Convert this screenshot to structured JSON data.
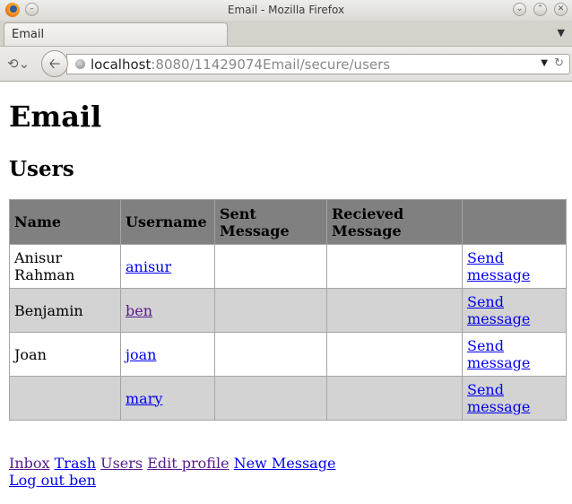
{
  "window": {
    "title": "Email - Mozilla Firefox"
  },
  "tab": {
    "label": "Email"
  },
  "urlbar": {
    "host": "localhost",
    "rest": ":8080/11429074Email/secure/users"
  },
  "page": {
    "heading": "Email",
    "subheading": "Users",
    "table": {
      "headers": {
        "name": "Name",
        "username": "Username",
        "sent": "Sent Message",
        "received": "Recieved Message",
        "action": ""
      },
      "rows": [
        {
          "name": "Anisur Rahman",
          "username": "anisur",
          "sent": "",
          "received": "",
          "action": "Send message"
        },
        {
          "name": "Benjamin",
          "username": "ben",
          "sent": "",
          "received": "",
          "action": "Send message"
        },
        {
          "name": "Joan",
          "username": "joan",
          "sent": "",
          "received": "",
          "action": "Send message"
        },
        {
          "name": "",
          "username": "mary",
          "sent": "",
          "received": "",
          "action": "Send message"
        }
      ]
    },
    "nav": {
      "inbox": "Inbox",
      "trash": "Trash",
      "users": "Users",
      "edit_profile": "Edit profile",
      "new_message": "New Message",
      "logout": "Log out ben"
    }
  }
}
